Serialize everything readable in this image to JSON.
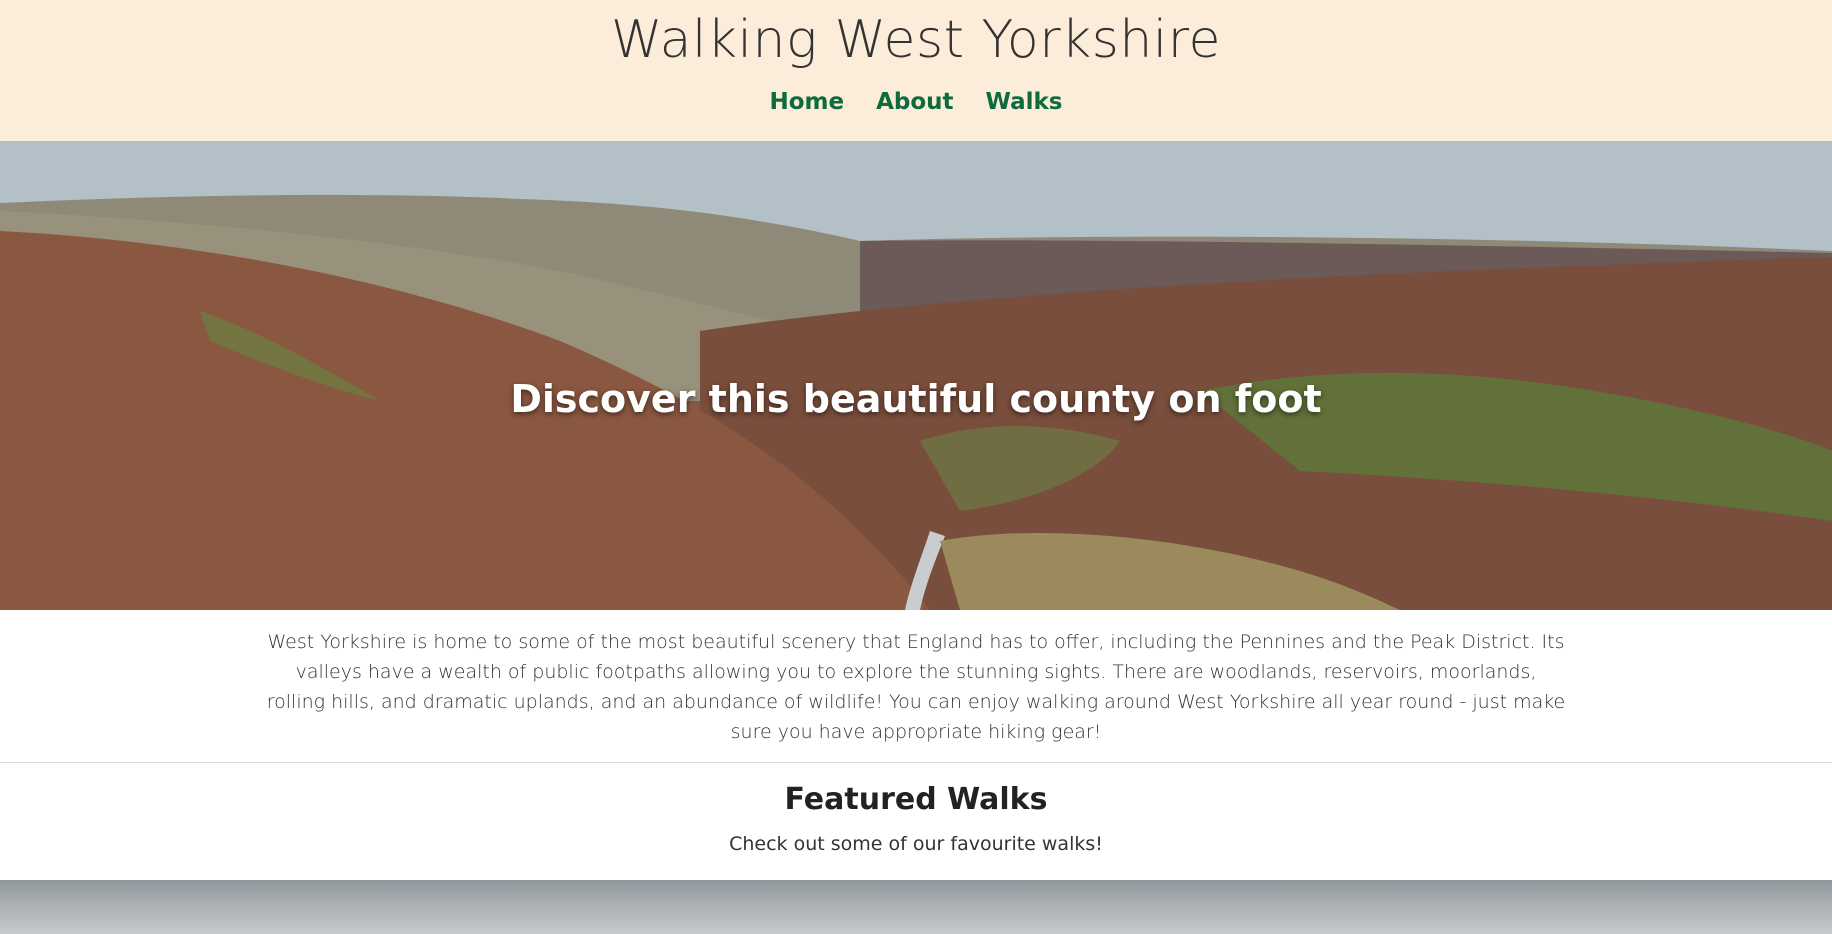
{
  "site": {
    "title": "Walking West Yorkshire",
    "nav": [
      "Home",
      "About",
      "Walks"
    ]
  },
  "hero": {
    "caption": "Discover this beautiful county on foot"
  },
  "intro": {
    "text": "West Yorkshire is home to some of the most beautiful scenery that England has to offer, including the Pennines and the Peak District. Its valleys have a wealth of public footpaths allowing you to explore the stunning sights. There are woodlands, reservoirs, moorlands, rolling hills, and dramatic uplands, and an abundance of wildlife! You can enjoy walking around West Yorkshire all year round - just make sure you have appropriate hiking gear!"
  },
  "featured": {
    "title": "Featured Walks",
    "subtitle": "Check out some of our favourite walks!"
  },
  "colors": {
    "header_bg": "#fcecda",
    "nav_link": "#0e6b3e"
  }
}
